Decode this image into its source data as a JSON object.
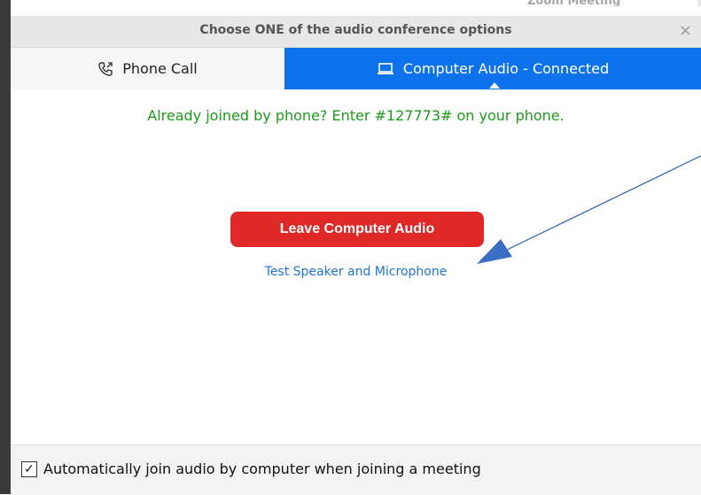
{
  "background_app": {
    "partial_title": "Zoom Meeting"
  },
  "dialog": {
    "title": "Choose ONE of the audio conference options",
    "close_symbol": "×",
    "tabs": {
      "phone": {
        "label": "Phone Call",
        "icon": "phone-icon"
      },
      "computer": {
        "label": "Computer Audio - Connected",
        "icon": "laptop-icon",
        "active": true
      }
    },
    "joined_message": "Already joined by phone? Enter #127773# on your phone.",
    "leave_button": "Leave Computer Audio",
    "test_link": "Test Speaker and Microphone",
    "auto_join": {
      "checked": true,
      "check_symbol": "✓",
      "label": "Automatically join audio by computer when joining a meeting"
    }
  },
  "annotation": {
    "type": "arrow",
    "color": "#2e63b8",
    "points_to": "Test Speaker and Microphone"
  },
  "colors": {
    "accent": "#0e72ed",
    "danger": "#e02828",
    "success": "#1c9a1c",
    "link": "#1f73d6"
  }
}
